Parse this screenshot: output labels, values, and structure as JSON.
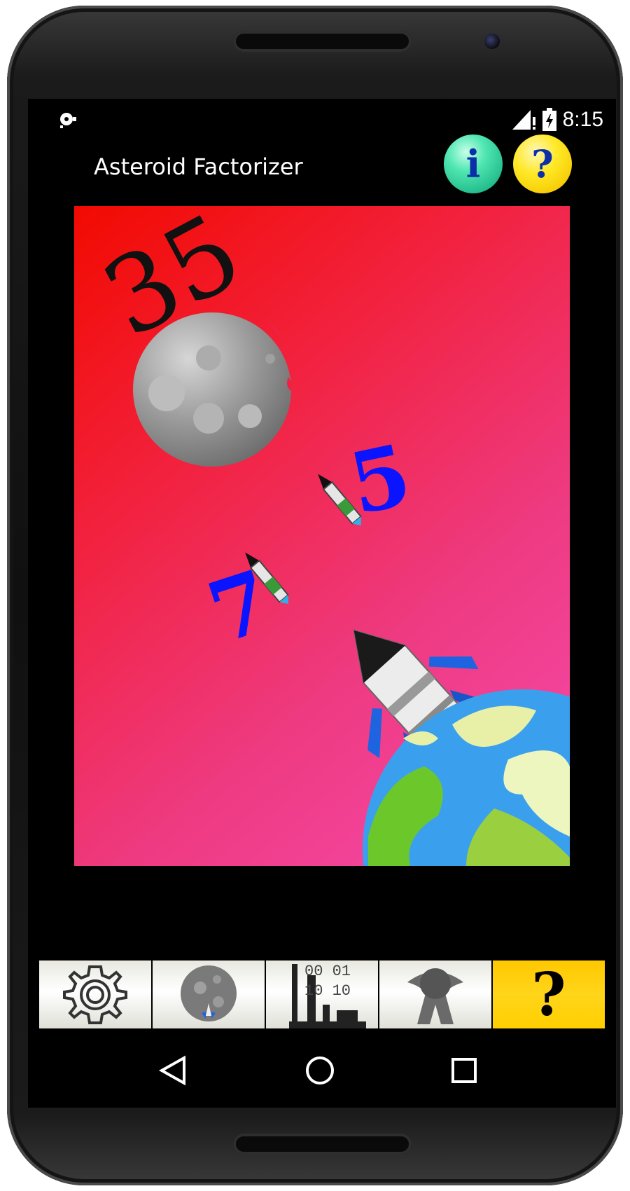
{
  "status_bar": {
    "time": "8:15",
    "icons": [
      "notification-icon",
      "signal-icon",
      "battery-icon"
    ]
  },
  "app": {
    "title": "Asteroid Factorizer",
    "info_button": {
      "label": "i",
      "icon": "info-icon"
    },
    "help_button": {
      "label": "?",
      "icon": "help-icon"
    }
  },
  "game": {
    "asteroid_number": "35",
    "factors": [
      {
        "value": "5",
        "color": "#0a14ff"
      },
      {
        "value": "7",
        "color": "#0a14ff"
      }
    ],
    "colors": {
      "asteroid_number": "#111111",
      "factor": "#0a14ff"
    }
  },
  "toolbar": {
    "items": [
      {
        "icon": "settings-gear-icon"
      },
      {
        "icon": "asteroid-rocket-icon"
      },
      {
        "icon": "binary-stats-icon",
        "text_lines": [
          "00 01",
          "10 10"
        ]
      },
      {
        "icon": "award-badge-icon"
      },
      {
        "icon": "help-icon",
        "label": "?"
      }
    ]
  },
  "navigation": {
    "icons": [
      "back-icon",
      "home-icon",
      "recents-icon"
    ]
  }
}
